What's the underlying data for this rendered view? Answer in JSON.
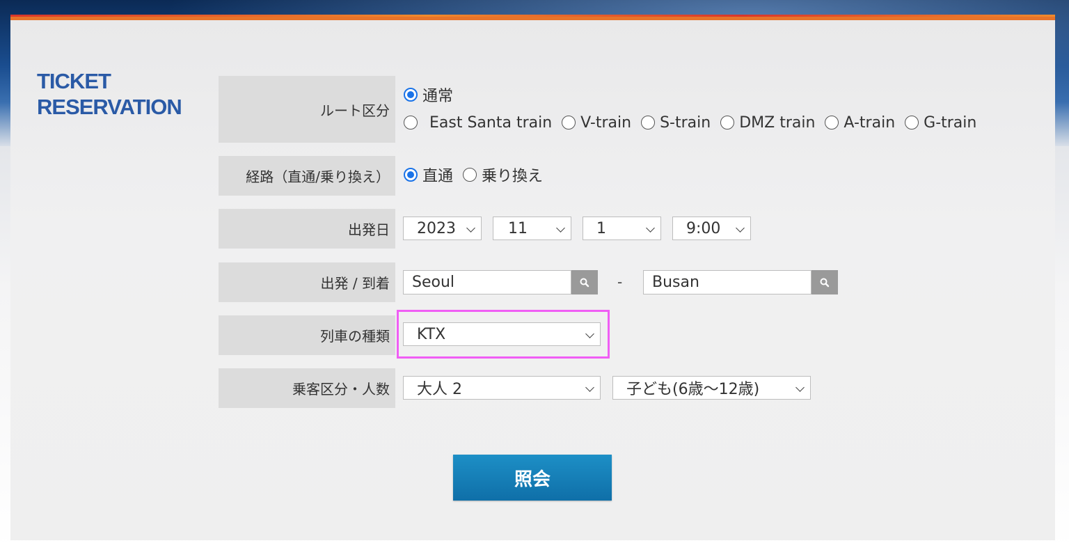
{
  "title": {
    "line1": "TICKET",
    "line2": "RESERVATION"
  },
  "route_type": {
    "label": "ルート区分",
    "options": [
      "通常",
      "East Santa train",
      "V-train",
      "S-train",
      "DMZ train",
      "A-train",
      "G-train"
    ],
    "selected": "通常"
  },
  "path": {
    "label": "経路（直通/乗り換え）",
    "options": [
      "直通",
      "乗り換え"
    ],
    "selected": "直通"
  },
  "departure_date": {
    "label": "出発日",
    "year": "2023",
    "month": "11",
    "day": "1",
    "time": "9:00"
  },
  "stations": {
    "label": "出発 / 到着",
    "from": "Seoul",
    "separator": "-",
    "to": "Busan"
  },
  "train_type": {
    "label": "列車の種類",
    "selected": "KTX"
  },
  "passengers": {
    "label": "乗客区分・人数",
    "adult": "大人 2",
    "child": "子ども(6歳〜12歳)"
  },
  "submit_label": "照会",
  "colors": {
    "accent": "#1a73e8",
    "title": "#2a5aa6",
    "button": "#1580b8",
    "highlight": "#f05ef5",
    "panel_top": "#e8742a"
  }
}
